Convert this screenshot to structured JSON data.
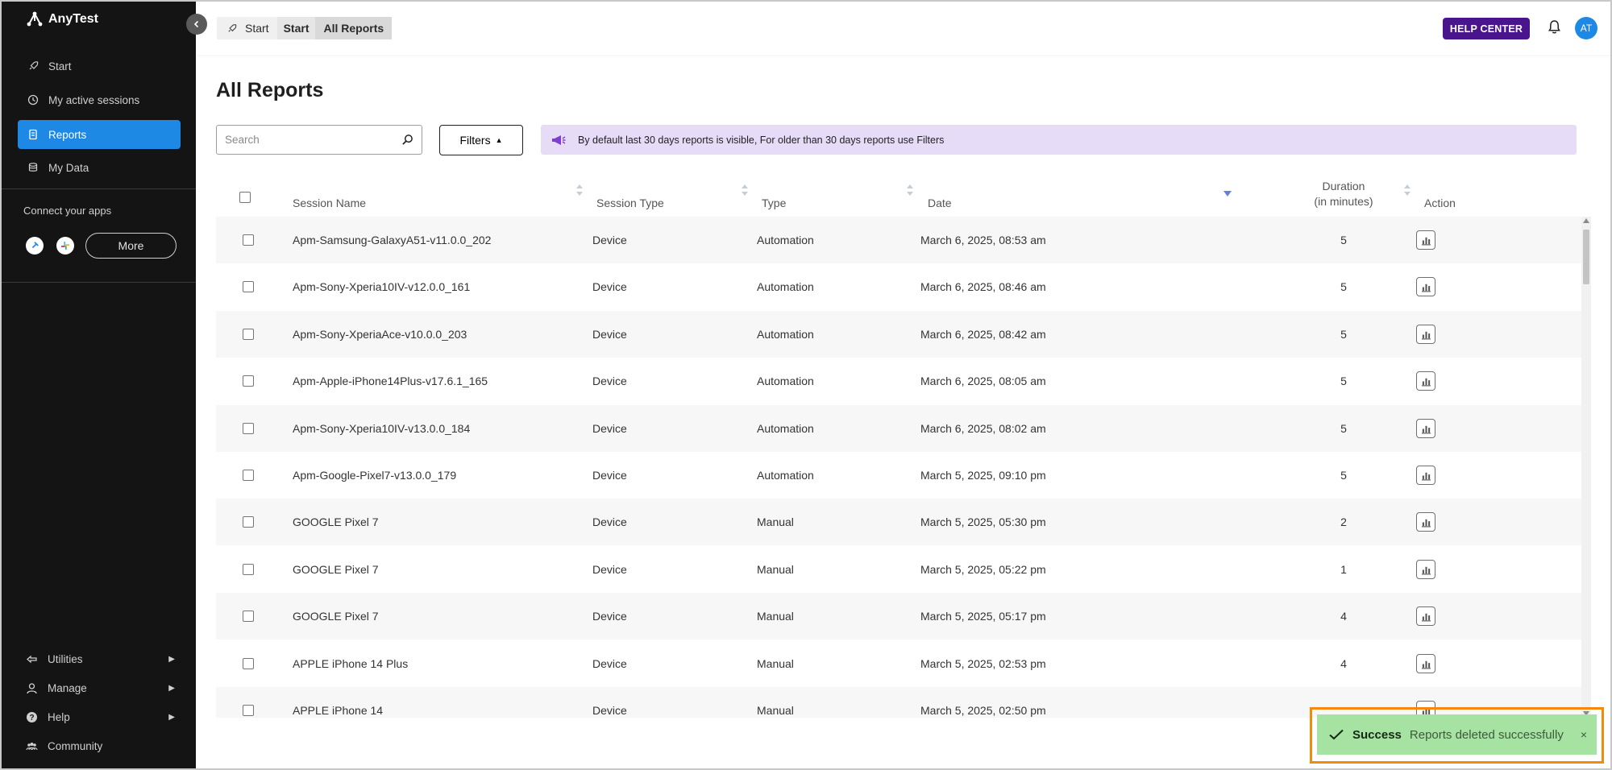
{
  "app": {
    "name": "AnyTest",
    "accent": "#1e88e5"
  },
  "sidebar": {
    "items": [
      {
        "label": "Start",
        "icon": "rocket-icon"
      },
      {
        "label": "My active sessions",
        "icon": "clock-icon"
      },
      {
        "label": "Reports",
        "icon": "report-icon",
        "active": true
      },
      {
        "label": "My Data",
        "icon": "database-icon"
      }
    ],
    "connect_label": "Connect your apps",
    "more_label": "More",
    "bottom": [
      {
        "label": "Utilities",
        "icon": "utilities-icon"
      },
      {
        "label": "Manage",
        "icon": "user-icon"
      },
      {
        "label": "Help",
        "icon": "help-icon"
      },
      {
        "label": "Community",
        "icon": "community-icon"
      }
    ]
  },
  "topbar": {
    "breadcrumbs": [
      "Start",
      "Start",
      "All Reports"
    ],
    "help_center": "HELP CENTER",
    "avatar": "AT"
  },
  "main": {
    "title": "All Reports",
    "search_placeholder": "Search",
    "filters_label": "Filters",
    "notice": "By default last 30 days reports is visible, For older than 30 days reports use Filters"
  },
  "table": {
    "columns": {
      "session_name": "Session Name",
      "session_type": "Session Type",
      "type": "Type",
      "date": "Date",
      "duration_line1": "Duration",
      "duration_line2": "(in minutes)",
      "action": "Action"
    },
    "rows": [
      {
        "name": "Apm-Samsung-GalaxyA51-v11.0.0_202",
        "session_type": "Device",
        "type": "Automation",
        "date": "March 6, 2025, 08:53 am",
        "duration": "5"
      },
      {
        "name": "Apm-Sony-Xperia10IV-v12.0.0_161",
        "session_type": "Device",
        "type": "Automation",
        "date": "March 6, 2025, 08:46 am",
        "duration": "5"
      },
      {
        "name": "Apm-Sony-XperiaAce-v10.0.0_203",
        "session_type": "Device",
        "type": "Automation",
        "date": "March 6, 2025, 08:42 am",
        "duration": "5"
      },
      {
        "name": "Apm-Apple-iPhone14Plus-v17.6.1_165",
        "session_type": "Device",
        "type": "Automation",
        "date": "March 6, 2025, 08:05 am",
        "duration": "5"
      },
      {
        "name": "Apm-Sony-Xperia10IV-v13.0.0_184",
        "session_type": "Device",
        "type": "Automation",
        "date": "March 6, 2025, 08:02 am",
        "duration": "5"
      },
      {
        "name": "Apm-Google-Pixel7-v13.0.0_179",
        "session_type": "Device",
        "type": "Automation",
        "date": "March 5, 2025, 09:10 pm",
        "duration": "5"
      },
      {
        "name": "GOOGLE Pixel 7",
        "session_type": "Device",
        "type": "Manual",
        "date": "March 5, 2025, 05:30 pm",
        "duration": "2"
      },
      {
        "name": "GOOGLE Pixel 7",
        "session_type": "Device",
        "type": "Manual",
        "date": "March 5, 2025, 05:22 pm",
        "duration": "1"
      },
      {
        "name": "GOOGLE Pixel 7",
        "session_type": "Device",
        "type": "Manual",
        "date": "March 5, 2025, 05:17 pm",
        "duration": "4"
      },
      {
        "name": "APPLE iPhone 14 Plus",
        "session_type": "Device",
        "type": "Manual",
        "date": "March 5, 2025, 02:53 pm",
        "duration": "4"
      },
      {
        "name": "APPLE iPhone 14",
        "session_type": "Device",
        "type": "Manual",
        "date": "March 5, 2025, 02:50 pm",
        "duration": ""
      }
    ]
  },
  "toast": {
    "title": "Success",
    "message": "Reports deleted successfully",
    "close": "×"
  }
}
